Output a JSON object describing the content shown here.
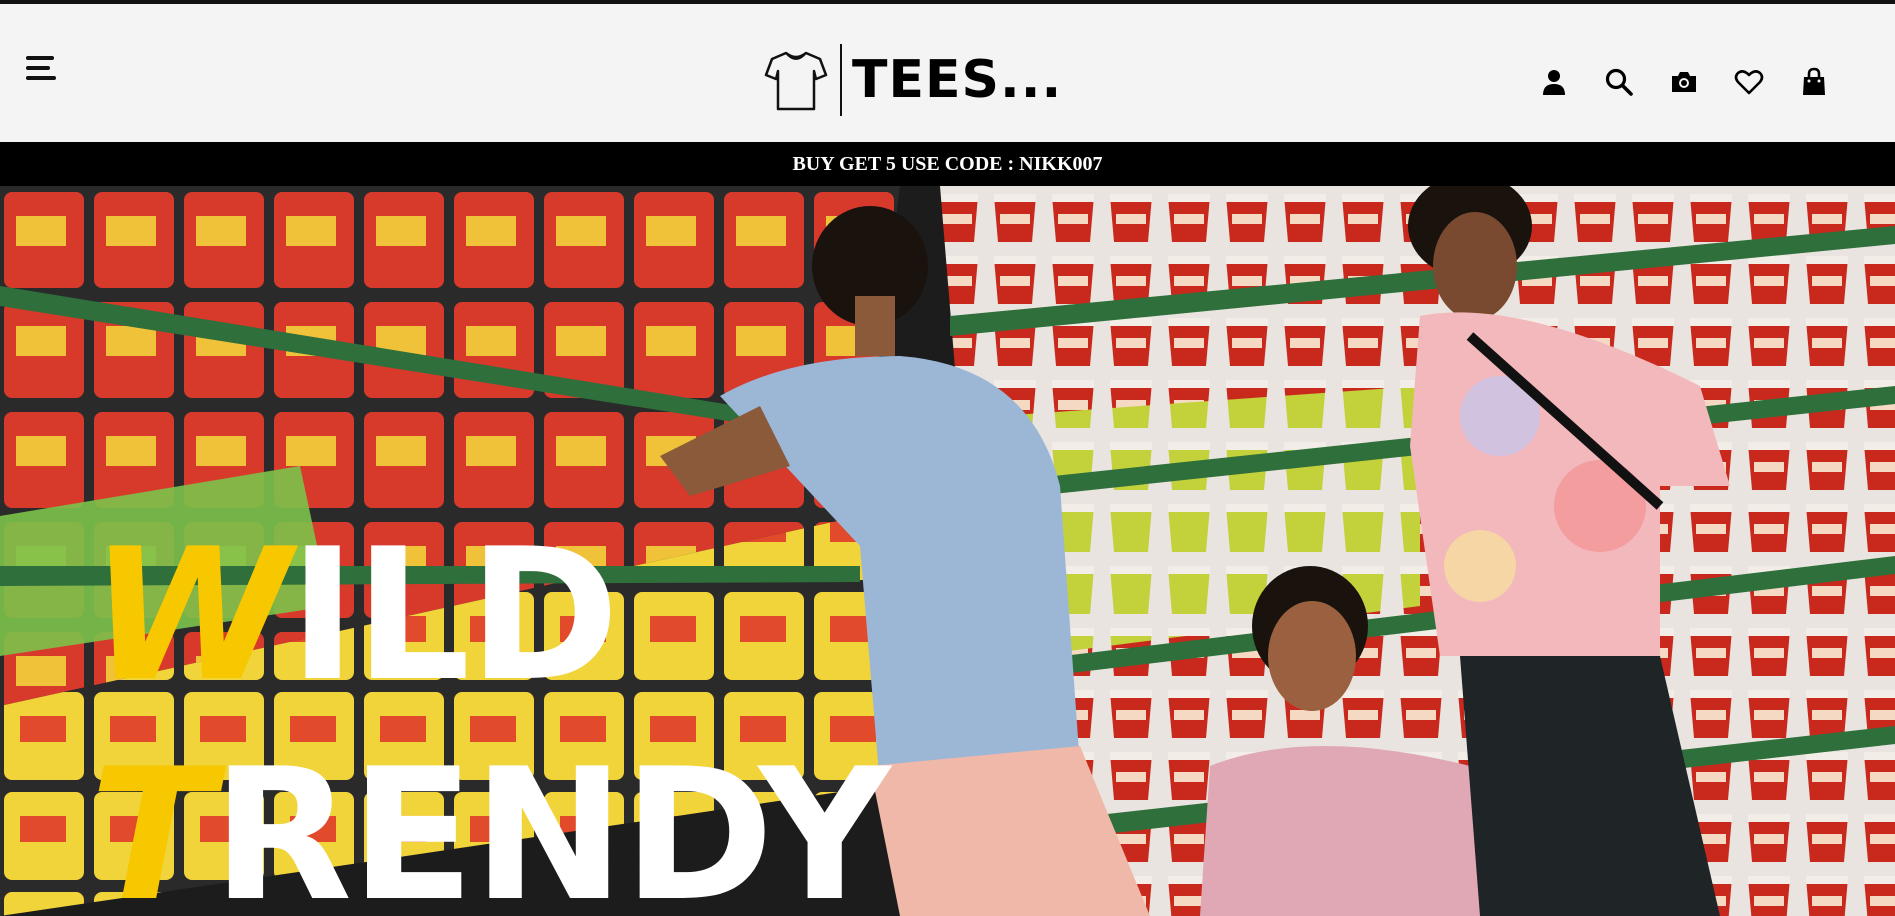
{
  "header": {
    "brand": "TEES...",
    "menu_icon": "hamburger-menu-icon",
    "icons": [
      "user-icon",
      "search-icon",
      "camera-icon",
      "heart-icon",
      "shopping-bag-icon"
    ]
  },
  "promo": {
    "text": "BUY GET 5 USE CODE : NIKK007"
  },
  "hero": {
    "line1_highlight": "W",
    "line1_rest": "ILD",
    "line2_highlight": "T",
    "line2_rest": "RENDY",
    "highlight_color": "#f7c700"
  },
  "colors": {
    "header_bg": "#f4f4f4",
    "promo_bg": "#000000",
    "accent": "#f7c700"
  }
}
